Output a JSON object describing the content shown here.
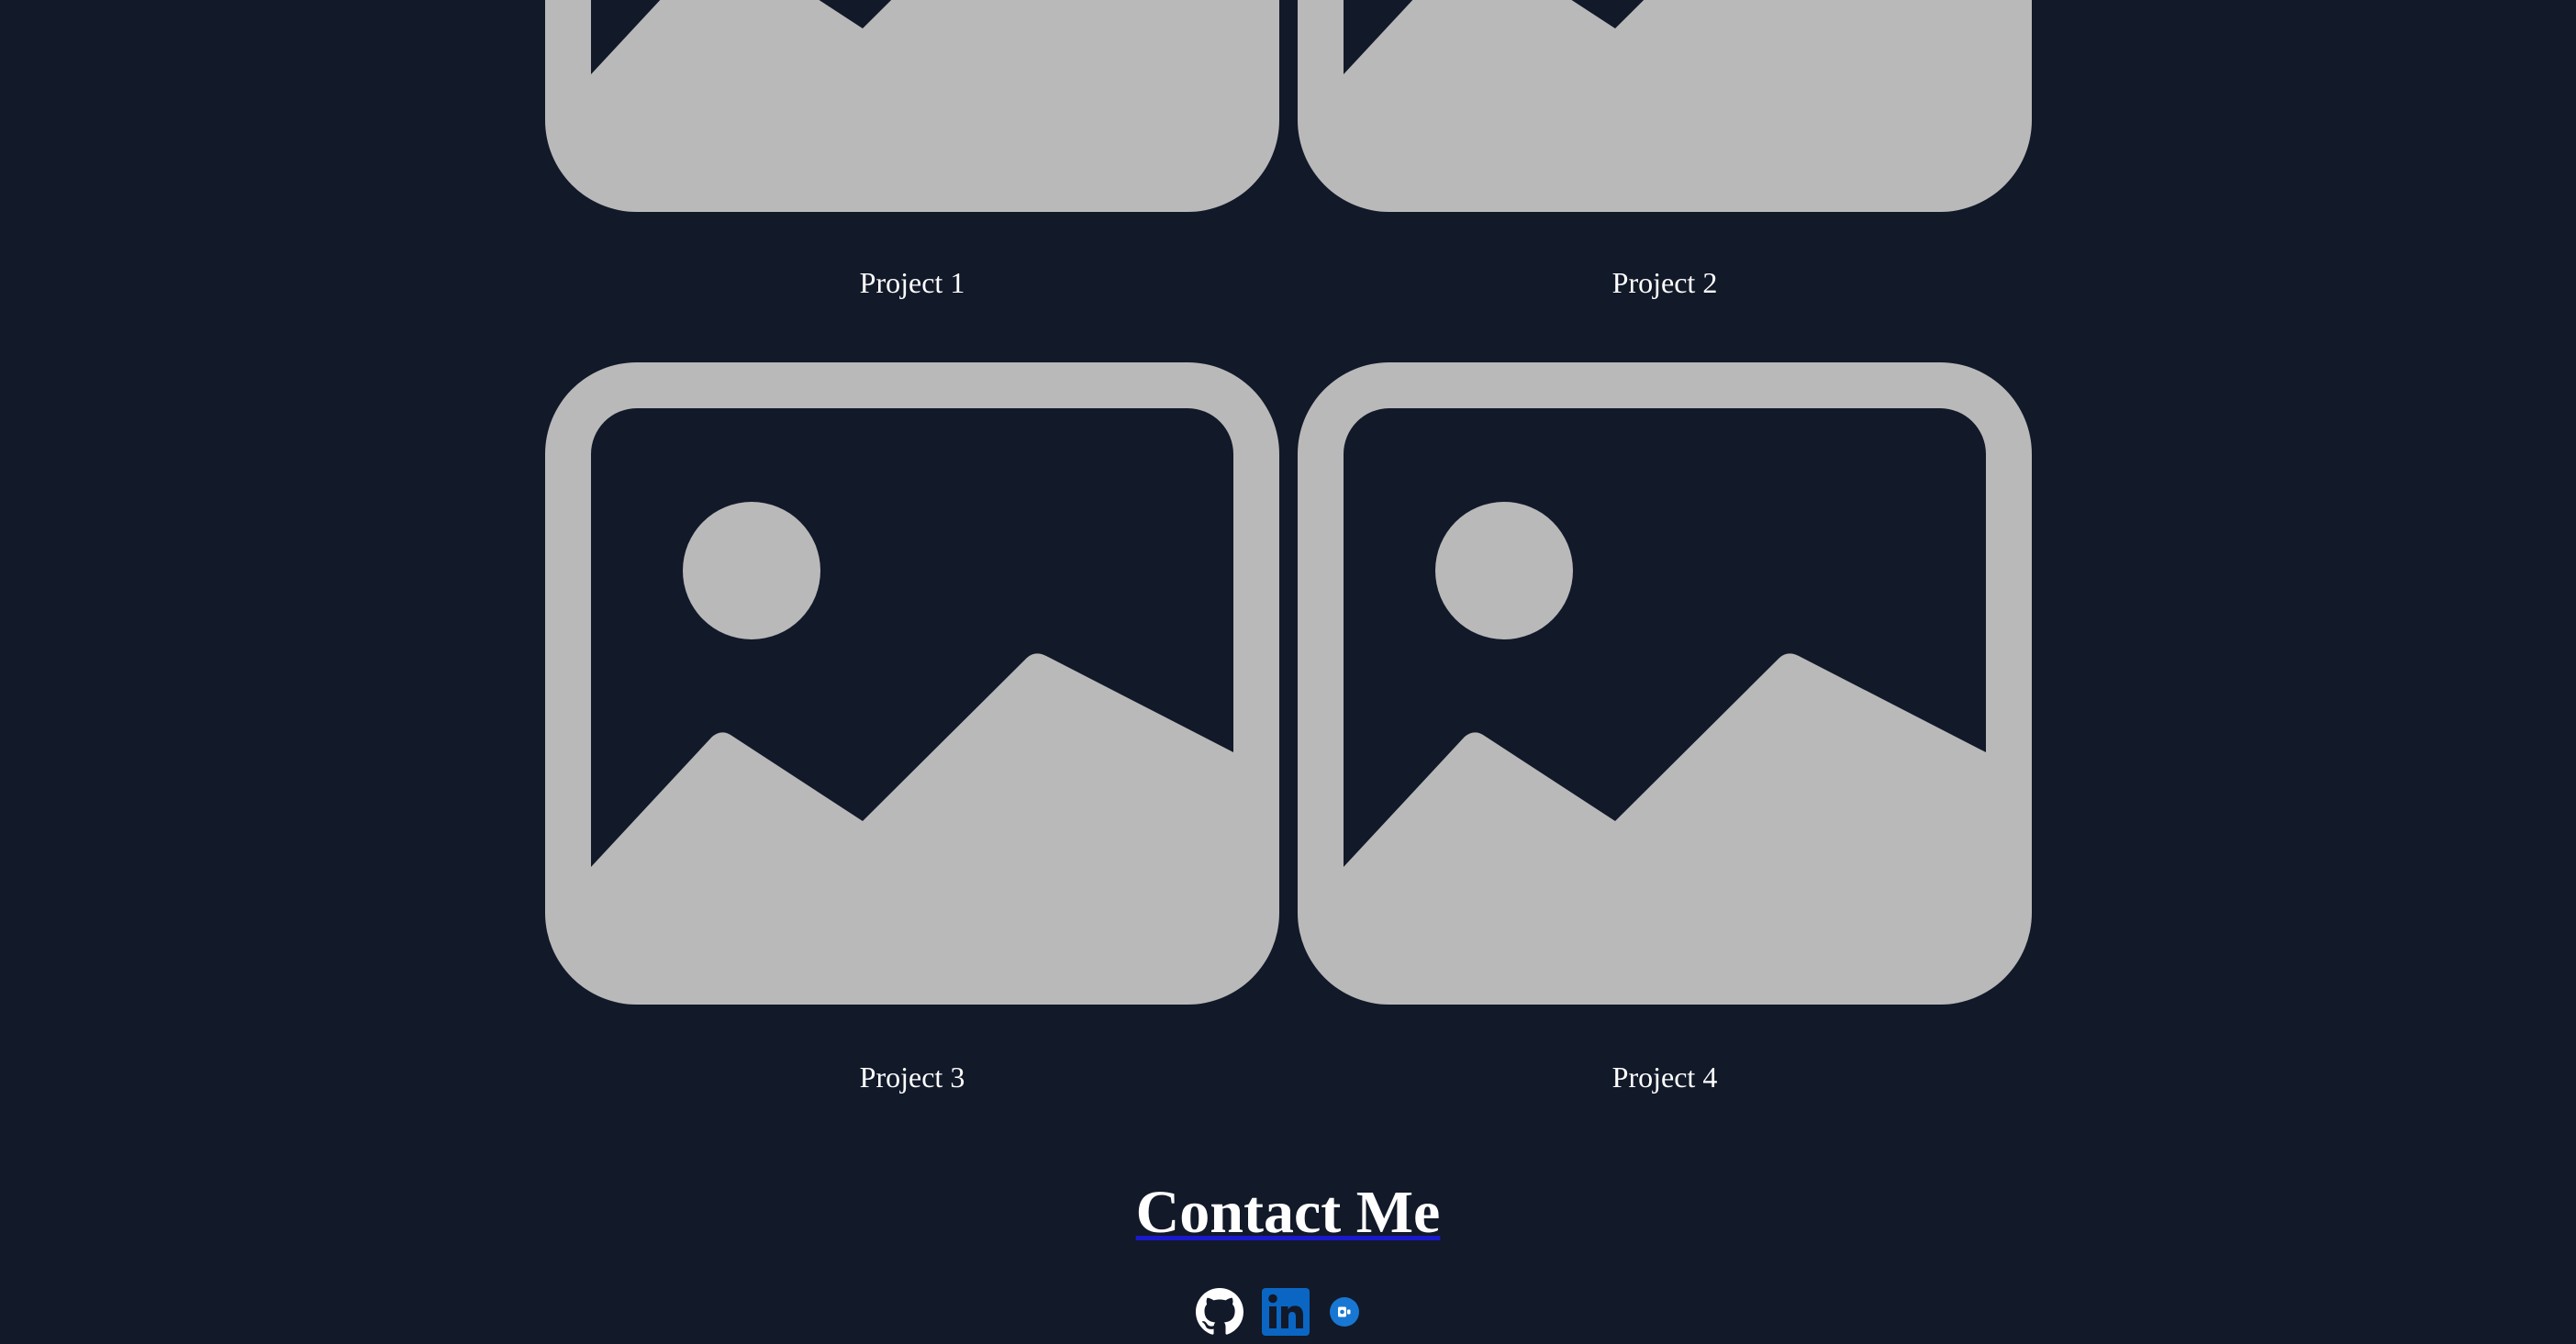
{
  "colors": {
    "background": "#121929",
    "placeholder": "#b9b9b9",
    "text": "#ffffff",
    "title_underline": "#1a1acc",
    "linkedin": "#0a66c2",
    "email_badge": "#1877d2"
  },
  "projects": [
    {
      "caption": "Project 1",
      "icon": "image-placeholder-icon"
    },
    {
      "caption": "Project 2",
      "icon": "image-placeholder-icon"
    },
    {
      "caption": "Project 3",
      "icon": "image-placeholder-icon"
    },
    {
      "caption": "Project 4",
      "icon": "image-placeholder-icon"
    }
  ],
  "contact": {
    "title": "Contact Me",
    "links": [
      {
        "icon": "github-icon"
      },
      {
        "icon": "linkedin-icon"
      },
      {
        "icon": "email-icon"
      }
    ]
  }
}
